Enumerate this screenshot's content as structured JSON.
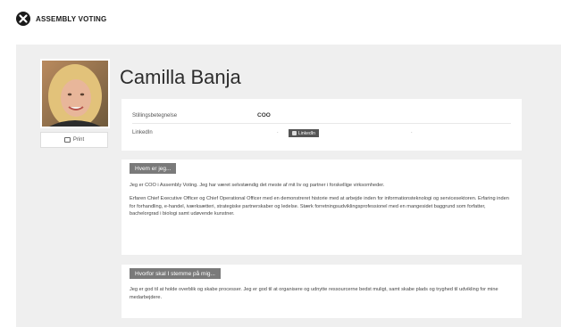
{
  "brand": {
    "name": "ASSEMBLY VOTING"
  },
  "profile": {
    "name": "Camilla Banja",
    "print_label": "Print",
    "fields": [
      {
        "label": "Stillingsbetegnelse",
        "value": "COO"
      },
      {
        "label": "LinkedIn",
        "button_label": "LinkedIn"
      }
    ]
  },
  "sections": [
    {
      "title": "Hvem er jeg...",
      "paragraphs": [
        "Jeg er COO i Assembly Voting. Jeg har været selvstændig det meste af mit liv og partner i forskellige virksomheder.",
        "Erfaren Chief Executive Officer og Chief Operational Officer med en demonstreret historie med at arbejde inden for informationsteknologi og servicesektoren. Erfaring inden for forhandling, e-handel, iværksætteri, strategiske partnerskaber og ledelse. Stærk forretningsudviklingsprofessionel med en mangesidet baggrund som forfatter, bachelorgrad i biologi samt udøvende kunstner."
      ]
    },
    {
      "title": "Hvorfor skal I stemme på mig...",
      "paragraphs": [
        "Jeg er god til at holde overblik og skabe processer. Jeg er god til at organisere og udnytte ressourcerne bedst muligt, samt skabe plads og tryghed til udvikling for mine medarbejdere."
      ]
    }
  ],
  "icons": {
    "logo": "assembly-voting-logo-icon",
    "print": "printer-icon",
    "linkedin": "linkedin-icon"
  }
}
